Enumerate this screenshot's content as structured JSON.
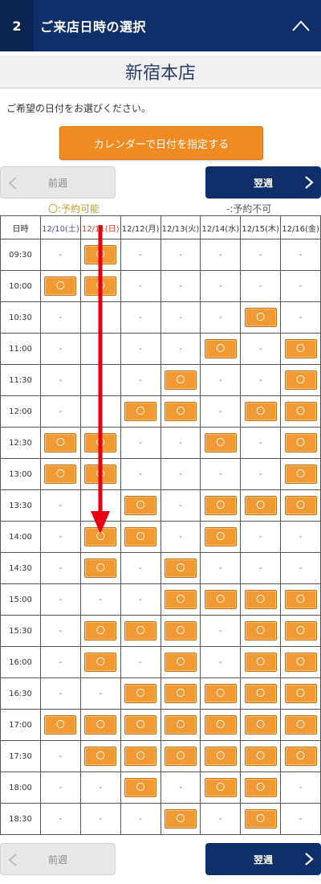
{
  "header": {
    "step": "2",
    "title": "ご来店日時の選択"
  },
  "store_name": "新宿本店",
  "instruction": "ご希望の日付をお選びください。",
  "calendar_button": "カレンダーで日付を指定する",
  "nav": {
    "prev": "前週",
    "next": "翌週"
  },
  "legend": {
    "available": "〇:予約可能",
    "unavailable": "-:予約不可"
  },
  "table": {
    "time_header": "日時",
    "days": [
      {
        "label": "12/10(土)",
        "kind": "sat"
      },
      {
        "label": "12/11(日)",
        "kind": "sun"
      },
      {
        "label": "12/12(月)",
        "kind": "wk"
      },
      {
        "label": "12/13(火)",
        "kind": "wk"
      },
      {
        "label": "12/14(水)",
        "kind": "wk"
      },
      {
        "label": "12/15(木)",
        "kind": "wk"
      },
      {
        "label": "12/16(金)",
        "kind": "wk"
      }
    ],
    "available_mark": "〇",
    "unavailable_mark": "-",
    "rows": [
      {
        "time": "09:30",
        "slots": [
          0,
          1,
          0,
          0,
          0,
          0,
          0
        ]
      },
      {
        "time": "10:00",
        "slots": [
          1,
          1,
          0,
          0,
          0,
          0,
          0
        ]
      },
      {
        "time": "10:30",
        "slots": [
          0,
          0,
          0,
          0,
          0,
          1,
          0
        ]
      },
      {
        "time": "11:00",
        "slots": [
          0,
          0,
          0,
          0,
          1,
          0,
          1
        ]
      },
      {
        "time": "11:30",
        "slots": [
          0,
          0,
          0,
          1,
          0,
          0,
          1
        ]
      },
      {
        "time": "12:00",
        "slots": [
          0,
          0,
          1,
          1,
          0,
          1,
          1
        ]
      },
      {
        "time": "12:30",
        "slots": [
          1,
          1,
          0,
          0,
          1,
          0,
          1
        ]
      },
      {
        "time": "13:00",
        "slots": [
          1,
          1,
          0,
          0,
          0,
          0,
          1
        ]
      },
      {
        "time": "13:30",
        "slots": [
          0,
          0,
          1,
          0,
          1,
          1,
          1
        ]
      },
      {
        "time": "14:00",
        "slots": [
          0,
          1,
          1,
          0,
          1,
          0,
          0
        ]
      },
      {
        "time": "14:30",
        "slots": [
          0,
          1,
          0,
          1,
          0,
          0,
          0
        ]
      },
      {
        "time": "15:00",
        "slots": [
          0,
          0,
          0,
          1,
          1,
          1,
          1
        ]
      },
      {
        "time": "15:30",
        "slots": [
          0,
          1,
          1,
          1,
          0,
          1,
          1
        ]
      },
      {
        "time": "16:00",
        "slots": [
          0,
          1,
          0,
          1,
          0,
          1,
          1
        ]
      },
      {
        "time": "16:30",
        "slots": [
          0,
          0,
          1,
          1,
          1,
          1,
          1
        ]
      },
      {
        "time": "17:00",
        "slots": [
          1,
          1,
          1,
          1,
          1,
          1,
          1
        ]
      },
      {
        "time": "17:30",
        "slots": [
          0,
          1,
          1,
          1,
          1,
          1,
          1
        ]
      },
      {
        "time": "18:00",
        "slots": [
          0,
          0,
          1,
          0,
          1,
          1,
          0
        ]
      },
      {
        "time": "18:30",
        "slots": [
          0,
          0,
          0,
          1,
          0,
          1,
          0
        ]
      }
    ]
  },
  "colors": {
    "header": "#0f2f6a",
    "accent": "#ef8b22",
    "arrow": "#e60012"
  },
  "icons": {
    "collapse": "chevron-up-icon",
    "prev": "chevron-left-icon",
    "next": "chevron-right-icon"
  }
}
